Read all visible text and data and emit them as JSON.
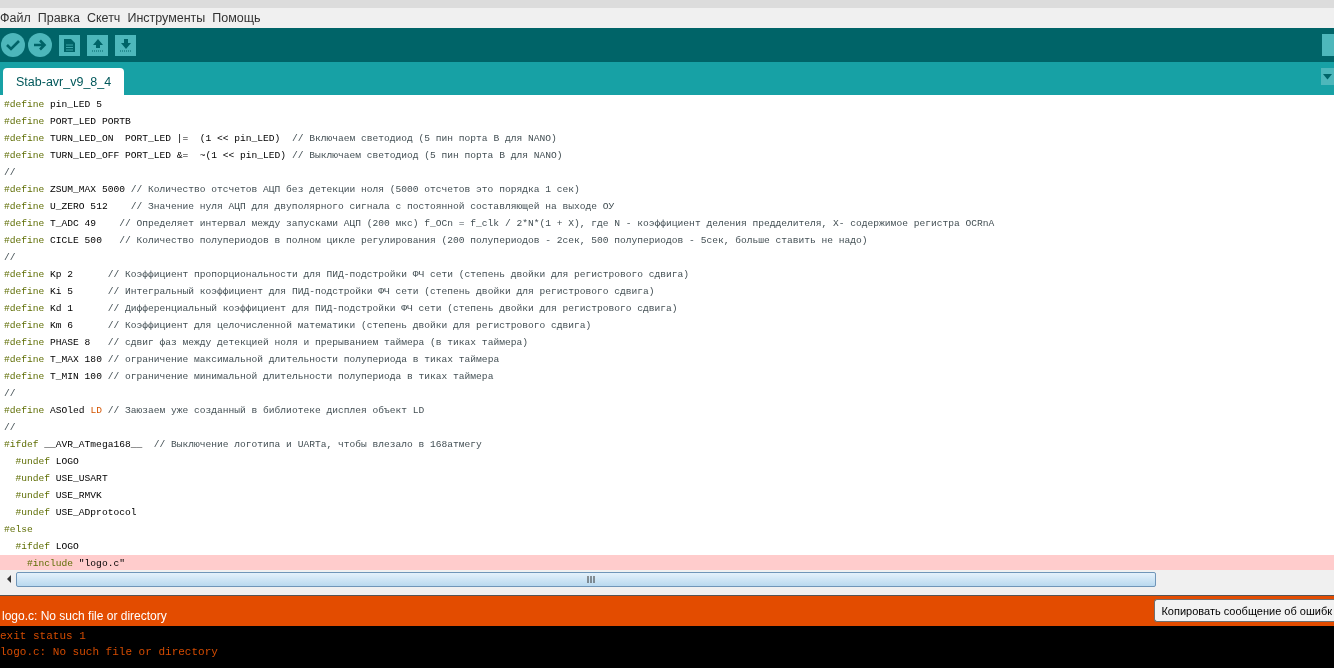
{
  "menu": [
    "Файл",
    "Правка",
    "Скетч",
    "Инструменты",
    "Помощь"
  ],
  "tabs": [
    {
      "label": "Stab-avr_v9_8_4",
      "selected": true
    }
  ],
  "editor": {
    "lines": [
      {
        "highlighted": false,
        "tokens": [
          {
            "kind": "keyword",
            "text": "#define"
          },
          {
            "kind": "text",
            "text": " pin_LED 5"
          }
        ]
      },
      {
        "highlighted": false,
        "tokens": [
          {
            "kind": "keyword",
            "text": "#define"
          },
          {
            "kind": "text",
            "text": " PORT_LED PORTB"
          }
        ]
      },
      {
        "highlighted": false,
        "tokens": [
          {
            "kind": "keyword",
            "text": "#define"
          },
          {
            "kind": "text",
            "text": " TURN_LED_ON  PORT_LED |=  (1 << pin_LED)  "
          },
          {
            "kind": "comment",
            "text": "// Включаем светодиод (5 пин порта B для NANO)"
          }
        ]
      },
      {
        "highlighted": false,
        "tokens": [
          {
            "kind": "keyword",
            "text": "#define"
          },
          {
            "kind": "text",
            "text": " TURN_LED_OFF PORT_LED &=  ~(1 << pin_LED) "
          },
          {
            "kind": "comment",
            "text": "// Выключаем светодиод (5 пин порта B для NANO)"
          }
        ]
      },
      {
        "highlighted": false,
        "tokens": [
          {
            "kind": "comment",
            "text": "//"
          }
        ]
      },
      {
        "highlighted": false,
        "tokens": [
          {
            "kind": "keyword",
            "text": "#define"
          },
          {
            "kind": "text",
            "text": " ZSUM_MAX 5000 "
          },
          {
            "kind": "comment",
            "text": "// Количество отсчетов АЦП без детекции ноля (5000 отсчетов это порядка 1 сек)"
          }
        ]
      },
      {
        "highlighted": false,
        "tokens": [
          {
            "kind": "keyword",
            "text": "#define"
          },
          {
            "kind": "text",
            "text": " U_ZERO 512    "
          },
          {
            "kind": "comment",
            "text": "// Значение нуля АЦП для двуполярного сигнала с постоянной составляющей на выходе ОУ"
          }
        ]
      },
      {
        "highlighted": false,
        "tokens": [
          {
            "kind": "keyword",
            "text": "#define"
          },
          {
            "kind": "text",
            "text": " T_ADC 49    "
          },
          {
            "kind": "comment",
            "text": "// Определяет интервал между запусками АЦП (200 мкс) f_OCn = f_clk / 2*N*(1 + X), где N - коэффициент деления предделителя, X- содержимое регистра OCRnA"
          }
        ]
      },
      {
        "highlighted": false,
        "tokens": [
          {
            "kind": "keyword",
            "text": "#define"
          },
          {
            "kind": "text",
            "text": " CICLE 500   "
          },
          {
            "kind": "comment",
            "text": "// Количество полупериодов в полном цикле регулирования (200 полупериодов - 2сек, 500 полупериодов - 5сек, больше ставить не надо)"
          }
        ]
      },
      {
        "highlighted": false,
        "tokens": [
          {
            "kind": "comment",
            "text": "//"
          }
        ]
      },
      {
        "highlighted": false,
        "tokens": [
          {
            "kind": "keyword",
            "text": "#define"
          },
          {
            "kind": "text",
            "text": " Kp 2      "
          },
          {
            "kind": "comment",
            "text": "// Коэффициент пропорциональности для ПИД-подстройки ФЧ сети (степень двойки для регистрового сдвига)"
          }
        ]
      },
      {
        "highlighted": false,
        "tokens": [
          {
            "kind": "keyword",
            "text": "#define"
          },
          {
            "kind": "text",
            "text": " Ki 5      "
          },
          {
            "kind": "comment",
            "text": "// Интегральный коэффициент для ПИД-подстройки ФЧ сети (степень двойки для регистрового сдвига)"
          }
        ]
      },
      {
        "highlighted": false,
        "tokens": [
          {
            "kind": "keyword",
            "text": "#define"
          },
          {
            "kind": "text",
            "text": " Kd 1      "
          },
          {
            "kind": "comment",
            "text": "// Дифференциальный коэффициент для ПИД-подстройки ФЧ сети (степень двойки для регистрового сдвига)"
          }
        ]
      },
      {
        "highlighted": false,
        "tokens": [
          {
            "kind": "keyword",
            "text": "#define"
          },
          {
            "kind": "text",
            "text": " Km 6      "
          },
          {
            "kind": "comment",
            "text": "// Коэффициент для целочисленной математики (степень двойки для регистрового сдвига)"
          }
        ]
      },
      {
        "highlighted": false,
        "tokens": [
          {
            "kind": "keyword",
            "text": "#define"
          },
          {
            "kind": "text",
            "text": " PHASE 8   "
          },
          {
            "kind": "comment",
            "text": "// сдвиг фаз между детекцией ноля и прерыванием таймера (в тиках таймера)"
          }
        ]
      },
      {
        "highlighted": false,
        "tokens": [
          {
            "kind": "keyword",
            "text": "#define"
          },
          {
            "kind": "text",
            "text": " T_MAX 180 "
          },
          {
            "kind": "comment",
            "text": "// ограничение максимальной длительности полупериода в тиках таймера"
          }
        ]
      },
      {
        "highlighted": false,
        "tokens": [
          {
            "kind": "keyword",
            "text": "#define"
          },
          {
            "kind": "text",
            "text": " T_MIN 100 "
          },
          {
            "kind": "comment",
            "text": "// ограничение минимальной длительности полупериода в тиках таймера"
          }
        ]
      },
      {
        "highlighted": false,
        "tokens": [
          {
            "kind": "comment",
            "text": "//"
          }
        ]
      },
      {
        "highlighted": false,
        "tokens": [
          {
            "kind": "keyword",
            "text": "#define"
          },
          {
            "kind": "text",
            "text": " ASOled "
          },
          {
            "kind": "literal",
            "text": "LD"
          },
          {
            "kind": "comment",
            "text": " // Заюзаем уже созданный в библиотеке дисплея объект LD"
          }
        ]
      },
      {
        "highlighted": false,
        "tokens": [
          {
            "kind": "comment",
            "text": "//"
          }
        ]
      },
      {
        "highlighted": false,
        "tokens": [
          {
            "kind": "keyword",
            "text": "#ifdef"
          },
          {
            "kind": "text",
            "text": " __AVR_ATmega168__  "
          },
          {
            "kind": "comment",
            "text": "// Выключение логотипа и UARTa, чтобы влезало в 168атмегу"
          }
        ]
      },
      {
        "highlighted": false,
        "tokens": [
          {
            "kind": "keyword",
            "text": "  #undef"
          },
          {
            "kind": "text",
            "text": " LOGO"
          }
        ]
      },
      {
        "highlighted": false,
        "tokens": [
          {
            "kind": "keyword",
            "text": "  #undef"
          },
          {
            "kind": "text",
            "text": " USE_USART"
          }
        ]
      },
      {
        "highlighted": false,
        "tokens": [
          {
            "kind": "keyword",
            "text": "  #undef"
          },
          {
            "kind": "text",
            "text": " USE_RMVK"
          }
        ]
      },
      {
        "highlighted": false,
        "tokens": [
          {
            "kind": "keyword",
            "text": "  #undef"
          },
          {
            "kind": "text",
            "text": " USE_ADprotocol"
          }
        ]
      },
      {
        "highlighted": false,
        "tokens": [
          {
            "kind": "keyword",
            "text": "#else"
          }
        ]
      },
      {
        "highlighted": false,
        "tokens": [
          {
            "kind": "keyword",
            "text": "  #ifdef"
          },
          {
            "kind": "text",
            "text": " LOGO"
          }
        ]
      },
      {
        "highlighted": true,
        "tokens": [
          {
            "kind": "keyword",
            "text": "    #include"
          },
          {
            "kind": "text",
            "text": " \"logo.c\""
          }
        ]
      }
    ]
  },
  "error_bar": {
    "message": "logo.c: No such file or directory",
    "button": "Копировать сообщение об ошибк"
  },
  "console": {
    "lines": [
      "exit status 1",
      "logo.c: No such file or directory"
    ]
  }
}
